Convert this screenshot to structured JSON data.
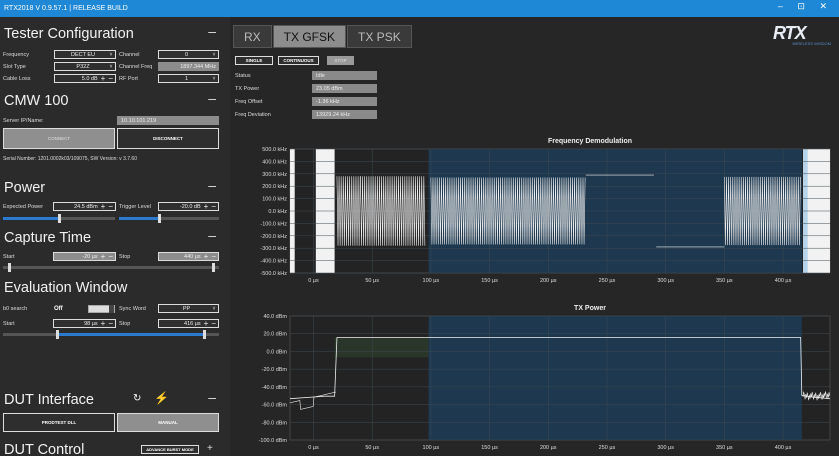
{
  "app": {
    "title": "RTX2018 V 0.9.57.1 | RELEASE BUILD"
  },
  "tester": {
    "title": "Tester Configuration",
    "freq_label": "Frequency",
    "freq_value": "DECT EU",
    "channel_label": "Channel",
    "channel_value": "0",
    "slot_label": "Slot Type",
    "slot_value": "P32Z",
    "chfreq_label": "Channel Freq",
    "chfreq_value": "1897.344 MHz",
    "cable_label": "Cable Loss",
    "cable_value": "5.0 dB",
    "rfport_label": "RF Port",
    "rfport_value": "1"
  },
  "cmw": {
    "title": "CMW 100",
    "server_label": "Server IP/Name:",
    "server_value": "10.10.101.219",
    "connect": "CONNECT",
    "disconnect": "DISCONNECT",
    "serial": "Serial Number: 1201.0002k03/109075, SW Version: v 3.7.60"
  },
  "power": {
    "title": "Power",
    "expected_label": "Expected Power",
    "expected_value": "24.5 dBm",
    "trigger_label": "Trigger Level",
    "trigger_value": "-20.0 dB",
    "expected_level": 0.5,
    "trigger_level": 0.4
  },
  "capture": {
    "title": "Capture Time",
    "start_label": "Start",
    "start_value": "-20 µs",
    "stop_label": "Stop",
    "stop_value": "440 µs",
    "start_level": 0.03,
    "stop_level": 0.97
  },
  "evalwin": {
    "title": "Evaluation Window",
    "b0_label": "b0 search",
    "b0_value": "Off",
    "sync_label": "Sync Word",
    "sync_value": "PP",
    "start_label": "Start",
    "start_value": "98 µs",
    "stop_label": "Stop",
    "stop_value": "416 µs",
    "start_level": 0.25,
    "stop_level": 0.93
  },
  "dut_interface": {
    "title": "DUT Interface",
    "prodtest": "PRODTEST DLL",
    "manual": "MANUAL"
  },
  "dut_control": {
    "title": "DUT Control",
    "advance": "ADVANCE BURST MODE"
  },
  "tabs": [
    "RX",
    "TX GFSK",
    "TX PSK"
  ],
  "controls": {
    "single": "SINGLE",
    "continuous": "CONTINUOUS",
    "stop": "STOP"
  },
  "results": {
    "status_label": "Status",
    "status_value": "Idle",
    "txpower_label": "TX Power",
    "txpower_value": "23.05 dBm",
    "freqoff_label": "Freq Offset",
    "freqoff_value": "-1.36 kHz",
    "freqdev_label": "Freq Deviation",
    "freqdev_value": "13929.24 kHz"
  },
  "logo": {
    "text": "RTX",
    "tagline": "WIRELESS WISDOM"
  },
  "chart_data": [
    {
      "type": "line",
      "title": "Frequency Demodulation",
      "yticks": [
        "500.0 kHz",
        "400.0 kHz",
        "300.0 kHz",
        "200.0 kHz",
        "100.0 kHz",
        "0.0 kHz",
        "-100.0 kHz",
        "-200.0 kHz",
        "-300.0 kHz",
        "-400.0 kHz",
        "-500.0 kHz"
      ],
      "xticks": [
        "0 µs",
        "50 µs",
        "100 µs",
        "150 µs",
        "200 µs",
        "250 µs",
        "300 µs",
        "350 µs",
        "400 µs"
      ],
      "xlim": [
        -20,
        440
      ],
      "ylim": [
        -500,
        500
      ],
      "eval_window": [
        98,
        416
      ],
      "unit_y": "kHz",
      "unit_x": "µs",
      "segments": [
        {
          "x": [
            20,
            40
          ],
          "y": [
            -280,
            280
          ],
          "pattern": "burst"
        },
        {
          "x": [
            40,
            95
          ],
          "y": [
            -280,
            280
          ],
          "pattern": "burst"
        },
        {
          "x": [
            100,
            232
          ],
          "y": [
            -270,
            270
          ],
          "pattern": "burst"
        },
        {
          "x": [
            232,
            290
          ],
          "y": [
            290,
            290
          ],
          "pattern": "flat"
        },
        {
          "x": [
            292,
            350
          ],
          "y": [
            -290,
            -290
          ],
          "pattern": "flat"
        },
        {
          "x": [
            350,
            415
          ],
          "y": [
            -275,
            275
          ],
          "pattern": "burst"
        }
      ]
    },
    {
      "type": "line",
      "title": "TX Power",
      "yticks": [
        "40.0 dBm",
        "20.0 dBm",
        "0.0 dBm",
        "-20.0 dBm",
        "-40.0 dBm",
        "-60.0 dBm",
        "-80.0 dBm",
        "-100.0 dBm"
      ],
      "xticks": [
        "0 µs",
        "50 µs",
        "100 µs",
        "150 µs",
        "200 µs",
        "250 µs",
        "300 µs",
        "350 µs",
        "400 µs"
      ],
      "xlim": [
        -20,
        440
      ],
      "ylim": [
        -100,
        50
      ],
      "eval_window": [
        98,
        416
      ],
      "points": [
        [
          -20,
          -50
        ],
        [
          0,
          -48
        ],
        [
          10,
          -47
        ],
        [
          18,
          -47
        ],
        [
          20,
          24
        ],
        [
          415,
          24
        ],
        [
          416,
          -46
        ],
        [
          425,
          -48
        ],
        [
          440,
          -50
        ]
      ]
    }
  ]
}
